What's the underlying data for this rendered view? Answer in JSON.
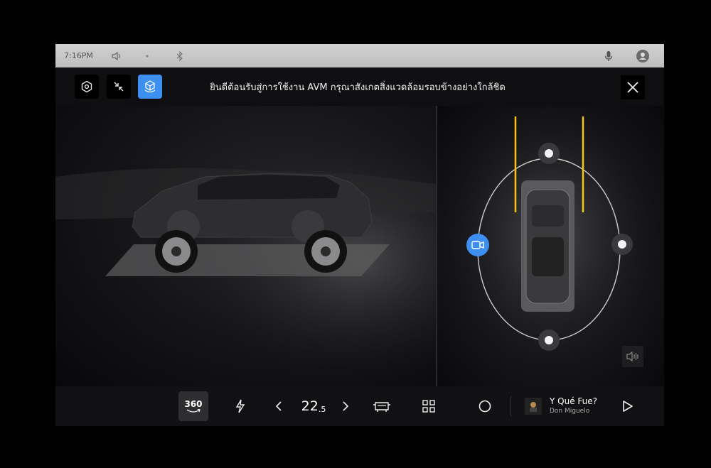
{
  "status_bar": {
    "time": "7:16PM"
  },
  "top_bar": {
    "title": "ยินดีต้อนรับสู่การใช้งาน AVM กรุณาสังเกตสิ่งแวดล้อมรอบข้างอย่างใกล้ชิด",
    "accent_color": "#3d8ff0"
  },
  "bottom_bar": {
    "view_360_label": "360",
    "temperature": {
      "whole": "22",
      "decimal": ".5"
    }
  },
  "media": {
    "track_title": "Y Qué Fue?",
    "artist": "Don Miguelo"
  },
  "icons": [
    "settings-icon",
    "minimize-icon",
    "3d-view-icon",
    "close-icon",
    "volume-icon",
    "bluetooth-icon",
    "microphone-icon",
    "user-icon",
    "lightning-icon",
    "chevron-left-icon",
    "chevron-right-icon",
    "car-seat-icon",
    "apps-grid-icon",
    "home-circle-icon",
    "play-icon",
    "camera-icon"
  ],
  "colors": {
    "guide_line": "#f3c614",
    "active_button": "#3d8ff0"
  }
}
